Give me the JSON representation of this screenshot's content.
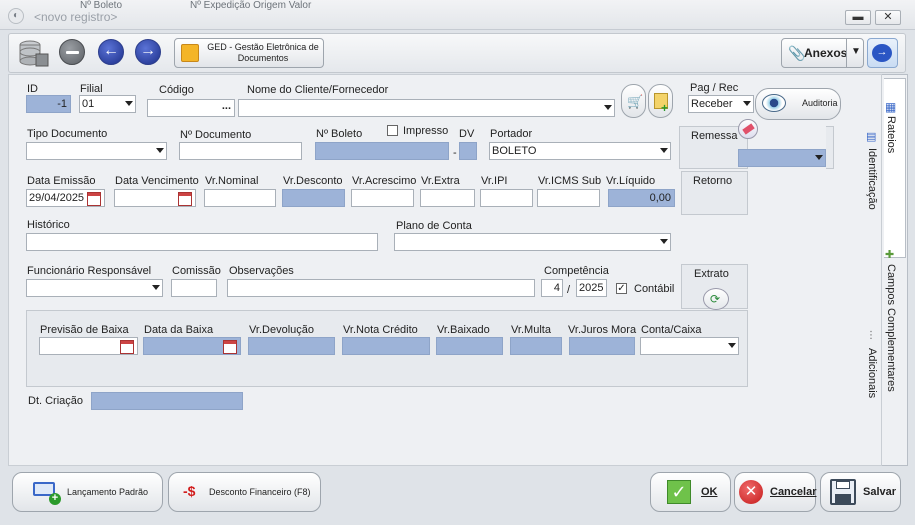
{
  "window": {
    "title": "<novo registro>",
    "ghost_left": "Nº Boleto",
    "ghost_right": "Nº Expedição  Origem  Valor",
    "minimize": "▬",
    "close": "✕"
  },
  "toolbar": {
    "ged_label": "GED - Gestão Eletrônica de Documentos",
    "anexos_label": "Anexos",
    "auditoria_label": "Auditoria"
  },
  "form": {
    "id_label": "ID",
    "id_value": "-1",
    "filial_label": "Filial",
    "filial_value": "01",
    "codigo_label": "Código",
    "codigo_btn": "...",
    "cliente_label": "Nome do Cliente/Fornecedor",
    "pagrec_label": "Pag / Rec",
    "pagrec_value": "Receber",
    "tipo_label": "Tipo Documento",
    "ndoc_label": "Nº Documento",
    "nboleto_label": "Nº Boleto",
    "impresso_label": "Impresso",
    "dv_label": "DV",
    "portador_label": "Portador",
    "portador_value": "BOLETO",
    "remessa_label": "Remessa",
    "emissao_label": "Data Emissão",
    "emissao_value": "29/04/2025",
    "vencimento_label": "Data Vencimento",
    "nominal_label": "Vr.Nominal",
    "desconto_label": "Vr.Desconto",
    "acrescimo_label": "Vr.Acrescimo",
    "extra_label": "Vr.Extra",
    "ipi_label": "Vr.IPI",
    "icms_label": "Vr.ICMS Sub",
    "liquido_label": "Vr.Líquido",
    "liquido_value": "0,00",
    "retorno_label": "Retorno",
    "historico_label": "Histórico",
    "plano_label": "Plano de Conta",
    "funcionario_label": "Funcionário Responsável",
    "comissao_label": "Comissão",
    "observacoes_label": "Observações",
    "competencia_label": "Competência",
    "comp_month": "4",
    "comp_sep": "/",
    "comp_year": "2025",
    "contabil_label": "Contábil",
    "extrato_label": "Extrato",
    "prev_baixa_label": "Previsão de Baixa",
    "data_baixa_label": "Data da Baixa",
    "devolucao_label": "Vr.Devolução",
    "nota_credito_label": "Vr.Nota Crédito",
    "baixado_label": "Vr.Baixado",
    "multa_label": "Vr.Multa",
    "juros_label": "Vr.Juros Mora",
    "conta_caixa_label": "Conta/Caixa",
    "dt_criacao_label": "Dt. Criação"
  },
  "side_tabs": {
    "rateios": "Rateios",
    "identificacao": "Identificação",
    "campos": "Campos Complementares",
    "adicionais": "Adicionais"
  },
  "footer": {
    "lancamento_label": "Lançamento Padrão",
    "desconto_fin_label": "Desconto Financeiro (F8)",
    "ok_label": "OK",
    "cancelar_label": "Cancelar",
    "salvar_label": "Salvar"
  },
  "colors": {
    "accent_blue": "#1c2f8a",
    "readonly_field": "#9db3d8"
  }
}
